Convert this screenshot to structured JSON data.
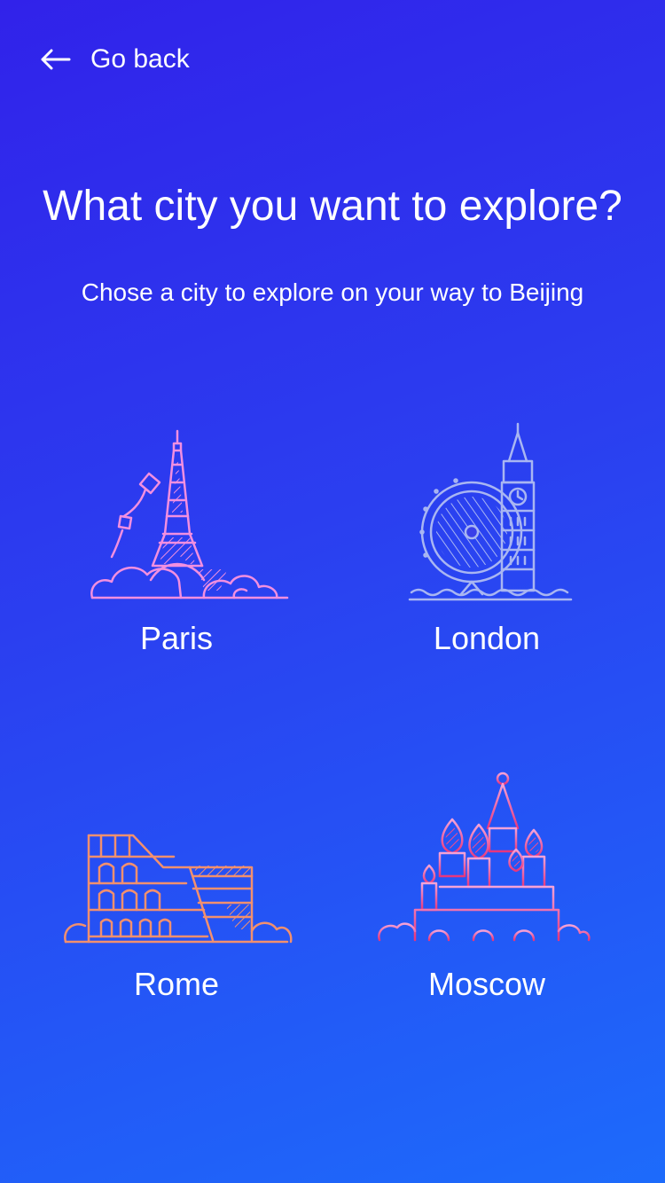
{
  "header": {
    "back_icon": "arrow-left-icon",
    "back_label": "Go back"
  },
  "main": {
    "title": "What city you want to explore?",
    "subtitle": "Chose a city to explore on your way to Beijing",
    "cities": [
      {
        "label": "Paris",
        "icon": "eiffel-tower-icon",
        "color": "#f28fe0"
      },
      {
        "label": "London",
        "icon": "big-ben-london-eye-icon",
        "color": "#a9b6f2"
      },
      {
        "label": "Rome",
        "icon": "colosseum-icon",
        "color": "#f2906e"
      },
      {
        "label": "Moscow",
        "icon": "saint-basils-cathedral-icon",
        "color": "#f04a8e"
      }
    ]
  },
  "colors": {
    "background_top": "#3122ea",
    "background_bottom": "#1d6bfb",
    "text": "#ffffff"
  }
}
